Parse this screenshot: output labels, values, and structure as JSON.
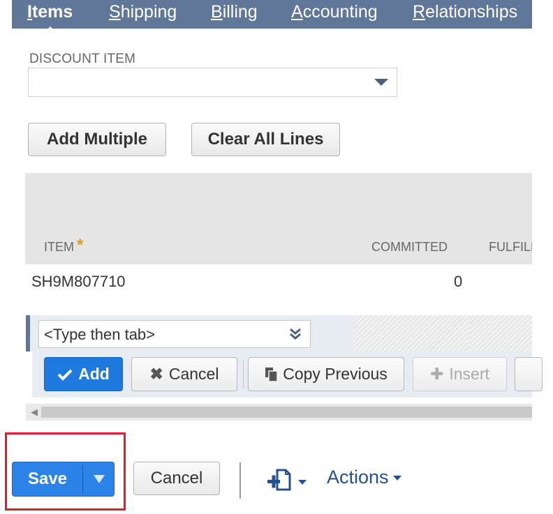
{
  "tabs": [
    {
      "label": "Items",
      "key": "I",
      "rest": "tems",
      "active": true
    },
    {
      "label": "Shipping",
      "key": "S",
      "rest": "hipping",
      "active": false
    },
    {
      "label": "Billing",
      "key": "B",
      "rest": "illing",
      "active": false
    },
    {
      "label": "Accounting",
      "key": "A",
      "rest": "ccounting",
      "active": false
    },
    {
      "label": "Relationships",
      "key": "R",
      "rest": "elationships",
      "active": false
    }
  ],
  "discount": {
    "label": "DISCOUNT ITEM",
    "value": ""
  },
  "buttons": {
    "add_multiple": "Add Multiple",
    "clear_all": "Clear All Lines"
  },
  "table": {
    "columns": [
      "ITEM",
      "COMMITTED",
      "FULFILL"
    ],
    "required_marker": "*",
    "rows": [
      {
        "item": "SH9M807710",
        "committed": "0"
      }
    ]
  },
  "edit_row": {
    "placeholder": "<Type then tab>"
  },
  "line_toolbar": {
    "add": "Add",
    "cancel": "Cancel",
    "copy_previous": "Copy Previous",
    "insert": "Insert"
  },
  "footer": {
    "save": "Save",
    "cancel": "Cancel",
    "actions": "Actions"
  },
  "colors": {
    "tabbar": "#607799",
    "primary": "#2b83e8",
    "highlight": "#e11d2b"
  }
}
